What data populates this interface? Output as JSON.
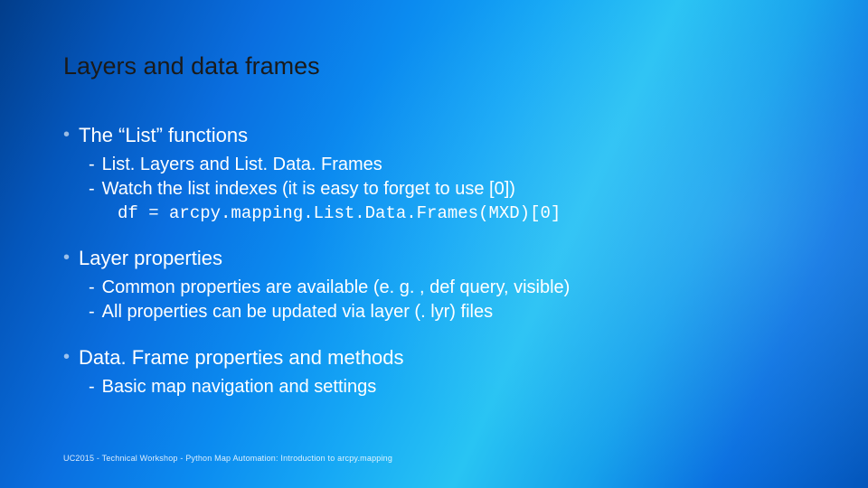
{
  "title": "Layers and data frames",
  "sections": [
    {
      "heading": "The “List” functions",
      "items": [
        "List. Layers and List. Data. Frames",
        "Watch the list indexes (it is easy to forget to use [0])"
      ],
      "code": "df = arcpy.mapping.List.Data.Frames(MXD)[0]"
    },
    {
      "heading": "Layer properties",
      "items": [
        "Common properties are available (e. g. , def query, visible)",
        "All properties can be updated via layer (. lyr) files"
      ]
    },
    {
      "heading": "Data. Frame properties and methods",
      "items": [
        "Basic map navigation and settings"
      ]
    }
  ],
  "footer": "UC2015 - Technical Workshop - Python Map Automation: Introduction to arcpy.mapping"
}
